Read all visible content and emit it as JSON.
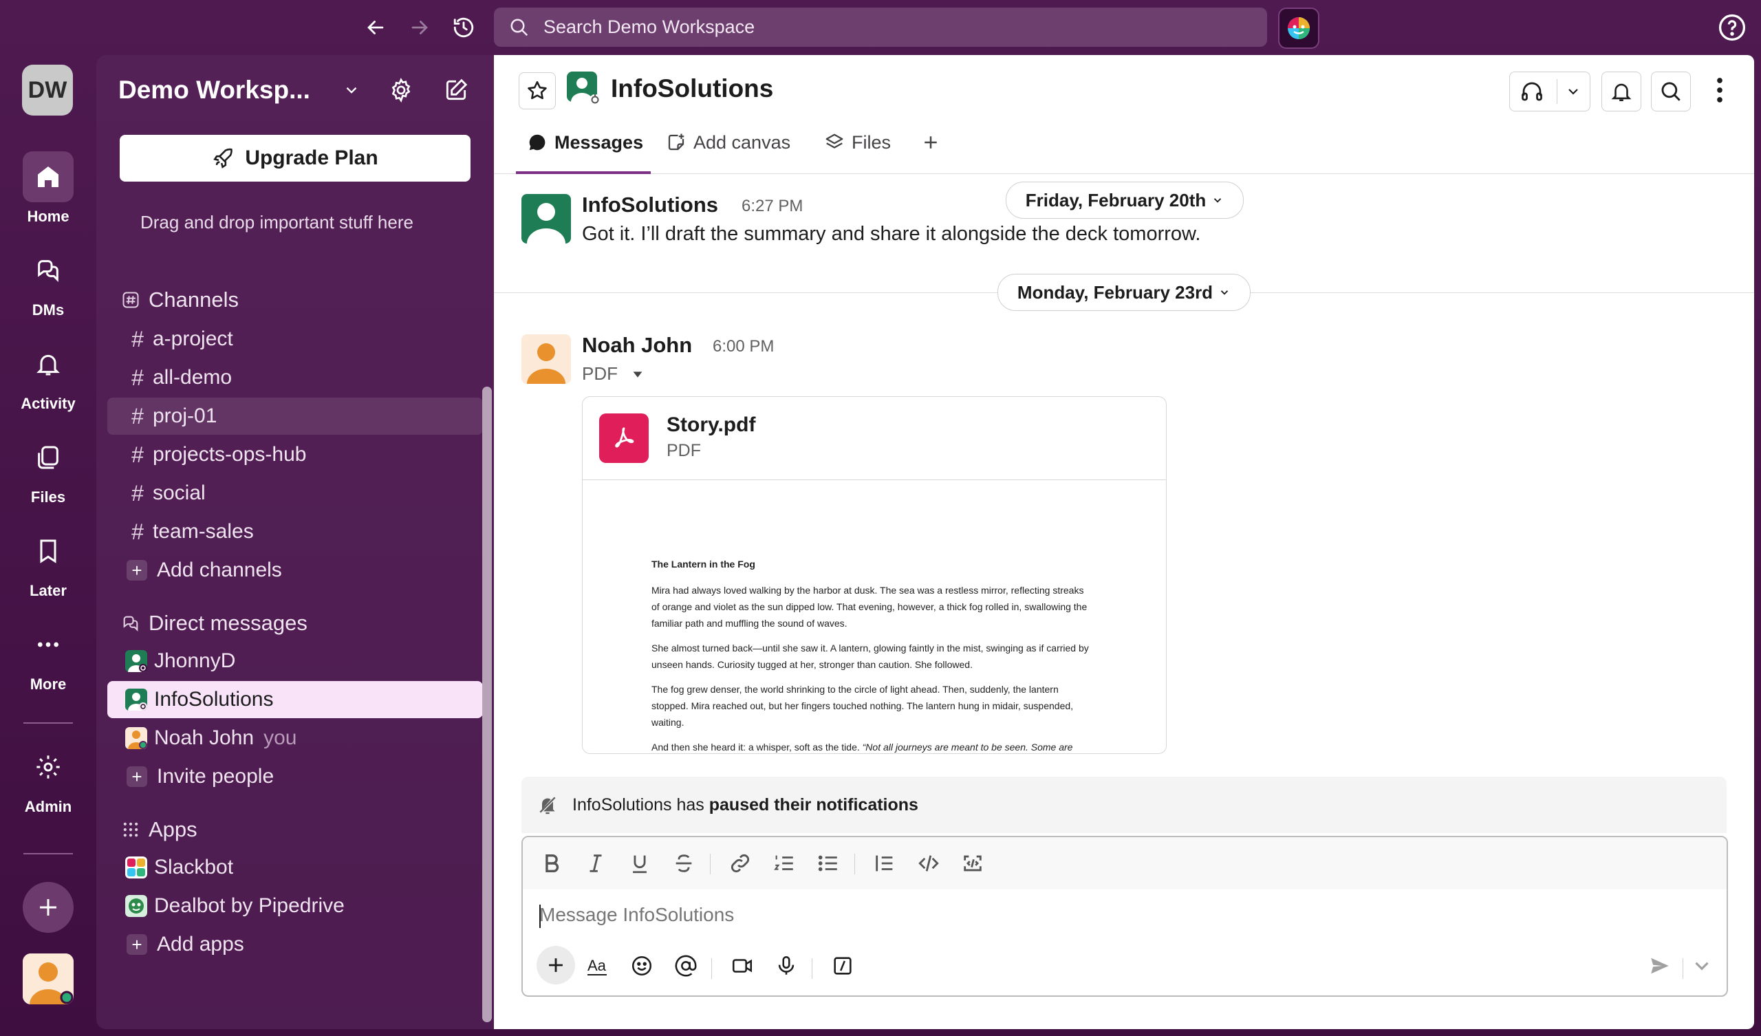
{
  "topbar": {
    "search_placeholder": "Search Demo Workspace"
  },
  "rail": {
    "workspace_initials": "DW",
    "items": [
      {
        "label": "Home"
      },
      {
        "label": "DMs"
      },
      {
        "label": "Activity"
      },
      {
        "label": "Files"
      },
      {
        "label": "Later"
      },
      {
        "label": "More"
      },
      {
        "label": "Admin"
      }
    ]
  },
  "sidebar": {
    "workspace_name": "Demo Worksp...",
    "upgrade_label": "Upgrade Plan",
    "starred_hint": "Drag and drop important stuff here",
    "channels_header": "Channels",
    "channels": [
      "a-project",
      "all-demo",
      "proj-01",
      "projects-ops-hub",
      "social",
      "team-sales"
    ],
    "add_channels": "Add channels",
    "dm_header": "Direct messages",
    "dms": [
      {
        "name": "JhonnyD",
        "suffix": ""
      },
      {
        "name": "InfoSolutions",
        "suffix": ""
      },
      {
        "name": "Noah John",
        "suffix": "you"
      }
    ],
    "invite_people": "Invite people",
    "apps_header": "Apps",
    "apps": [
      "Slackbot",
      "Dealbot by Pipedrive"
    ],
    "add_apps": "Add apps"
  },
  "channel": {
    "title": "InfoSolutions",
    "tabs": [
      "Messages",
      "Add canvas",
      "Files"
    ]
  },
  "messages": [
    {
      "author": "InfoSolutions",
      "time": "6:27 PM",
      "text": "Got it. I’ll draft the summary and share it alongside the deck tomorrow."
    },
    {
      "author": "Noah John",
      "time": "6:00 PM",
      "text": "PDF"
    }
  ],
  "dates": {
    "first": "Friday, February 20th",
    "second": "Monday, February 23rd"
  },
  "file": {
    "name": "Story.pdf",
    "type": "PDF",
    "preview": {
      "title": "The Lantern in the Fog",
      "p1": "Mira had always loved walking by the harbor at dusk. The sea was a restless mirror, reflecting streaks of orange and violet as the sun dipped low. That evening, however, a thick fog rolled in, swallowing the familiar path and muffling the sound of waves.",
      "p2": "She almost turned back—until she saw it. A lantern, glowing faintly in the mist, swinging as if carried by unseen hands. Curiosity tugged at her, stronger than caution. She followed.",
      "p3": "The fog grew denser, the world shrinking to the circle of light ahead. Then, suddenly, the lantern stopped. Mira reached out, but her fingers touched nothing. The lantern hung in midair, suspended, waiting.",
      "p4_start": "And then she heard it: a whisper, soft as the tide.",
      "p4_quote": "“Not all journeys are meant to be seen. Some are meant to be felt.”"
    }
  },
  "paused_notice": {
    "prefix": "InfoSolutions has",
    "bold": "paused their notifications"
  },
  "composer": {
    "placeholder": "Message InfoSolutions"
  },
  "colors": {
    "aubergine": "#4a154b",
    "accent": "#7c3085",
    "pdf_red": "#e01e5a",
    "selected_row": "#f8e3f8"
  }
}
